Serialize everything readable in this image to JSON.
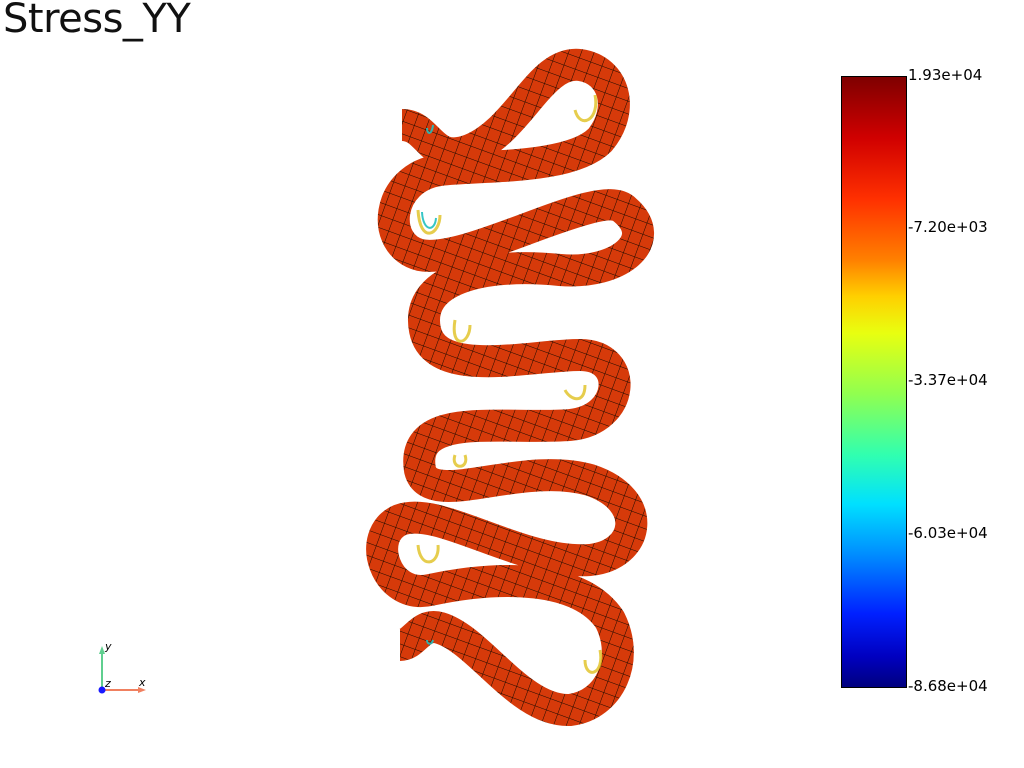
{
  "title": "Stress_YY",
  "colorbar": {
    "labels": [
      "1.93e+04",
      "-7.20e+03",
      "-3.37e+04",
      "-6.03e+04",
      "-8.68e+04"
    ],
    "max": "1.93e+04",
    "min": "-8.68e+04",
    "colormap": [
      "#7f0000",
      "#d00000",
      "#ff3000",
      "#ff8000",
      "#ffd000",
      "#e8ff10",
      "#90ff50",
      "#30ffb0",
      "#00e0ff",
      "#0090ff",
      "#0020ff",
      "#0000c0",
      "#00007f"
    ]
  },
  "axes": {
    "x": "x",
    "y": "y",
    "z": "z"
  },
  "colors": {
    "mesh_fill": "#d63a0a",
    "mesh_lines": "#1a0a00",
    "inner_edge_hot": "#e0b010",
    "inner_edge_cold": "#20c0c0"
  }
}
